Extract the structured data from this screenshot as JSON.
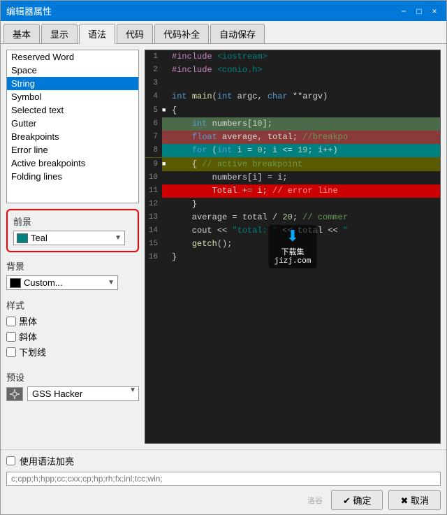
{
  "window": {
    "title": "编辑器属性",
    "close_btn": "×",
    "min_btn": "−",
    "max_btn": "□"
  },
  "tabs": [
    {
      "label": "基本",
      "active": false
    },
    {
      "label": "显示",
      "active": false
    },
    {
      "label": "语法",
      "active": true
    },
    {
      "label": "代码",
      "active": false
    },
    {
      "label": "代码补全",
      "active": false
    },
    {
      "label": "自动保存",
      "active": false
    }
  ],
  "syntax_items": [
    {
      "label": "Reserved Word",
      "selected": false
    },
    {
      "label": "Space",
      "selected": false
    },
    {
      "label": "String",
      "selected": true
    },
    {
      "label": "Symbol",
      "selected": false
    },
    {
      "label": "Selected text",
      "selected": false
    },
    {
      "label": "Gutter",
      "selected": false
    },
    {
      "label": "Breakpoints",
      "selected": false
    },
    {
      "label": "Error line",
      "selected": false
    },
    {
      "label": "Active breakpoints",
      "selected": false
    },
    {
      "label": "Folding lines",
      "selected": false
    }
  ],
  "foreground": {
    "label": "前景",
    "color": "#008080",
    "color_name": "Teal"
  },
  "background": {
    "label": "背景",
    "color": "#000000",
    "color_name": "Custom..."
  },
  "style": {
    "label": "样式",
    "bold_label": "黑体",
    "italic_label": "斜体",
    "underline_label": "下划线"
  },
  "preset": {
    "label": "预设",
    "value": "GSS Hacker"
  },
  "code": {
    "lines": [
      {
        "num": "1",
        "content": "#include <iostream>",
        "type": "include",
        "bg": ""
      },
      {
        "num": "2",
        "content": "#include <conio.h>",
        "type": "include",
        "bg": ""
      },
      {
        "num": "3",
        "content": "",
        "type": "empty",
        "bg": ""
      },
      {
        "num": "4",
        "content": "int main(int argc, char **argv)",
        "type": "funcdef",
        "bg": ""
      },
      {
        "num": "5",
        "content": "{",
        "type": "brace",
        "bg": "white-sq",
        "marker": true
      },
      {
        "num": "6",
        "content": "    int numbers[10];",
        "type": "stmt",
        "bg": "green"
      },
      {
        "num": "7",
        "content": "    float average, total; //breakpo",
        "type": "stmt",
        "bg": "breakpoint"
      },
      {
        "num": "8",
        "content": "    for (int i = 0; i <= 19; i++)",
        "type": "for",
        "bg": "teal"
      },
      {
        "num": "9",
        "content": "    { // active breakpoint",
        "type": "cmt",
        "bg": "activebp",
        "marker": true
      },
      {
        "num": "10",
        "content": "        numbers[i] = i;",
        "type": "stmt",
        "bg": ""
      },
      {
        "num": "11",
        "content": "        Total += i; // error line",
        "type": "error",
        "bg": "error"
      },
      {
        "num": "12",
        "content": "    }",
        "type": "brace",
        "bg": ""
      },
      {
        "num": "13",
        "content": "    average = total / 20; // commer",
        "type": "stmt",
        "bg": ""
      },
      {
        "num": "14",
        "content": "    cout << \"total: \" << total << \"",
        "type": "stmt",
        "bg": ""
      },
      {
        "num": "15",
        "content": "    getch();",
        "type": "stmt",
        "bg": ""
      },
      {
        "num": "16",
        "content": "}",
        "type": "brace",
        "bg": ""
      }
    ]
  },
  "bottom": {
    "highlight_label": "使用语法加亮",
    "file_ext_placeholder": "c;cpp;h;hpp;cc;cxx;cp;hp;rh;fx;inl;tcc;win;",
    "confirm_btn": "✔ 确定",
    "cancel_btn": "✖ 取消",
    "watermark": "洛谷"
  },
  "download_badge": {
    "arrow": "⬇",
    "text_line1": "下载集",
    "text_line2": "jizj.com"
  }
}
